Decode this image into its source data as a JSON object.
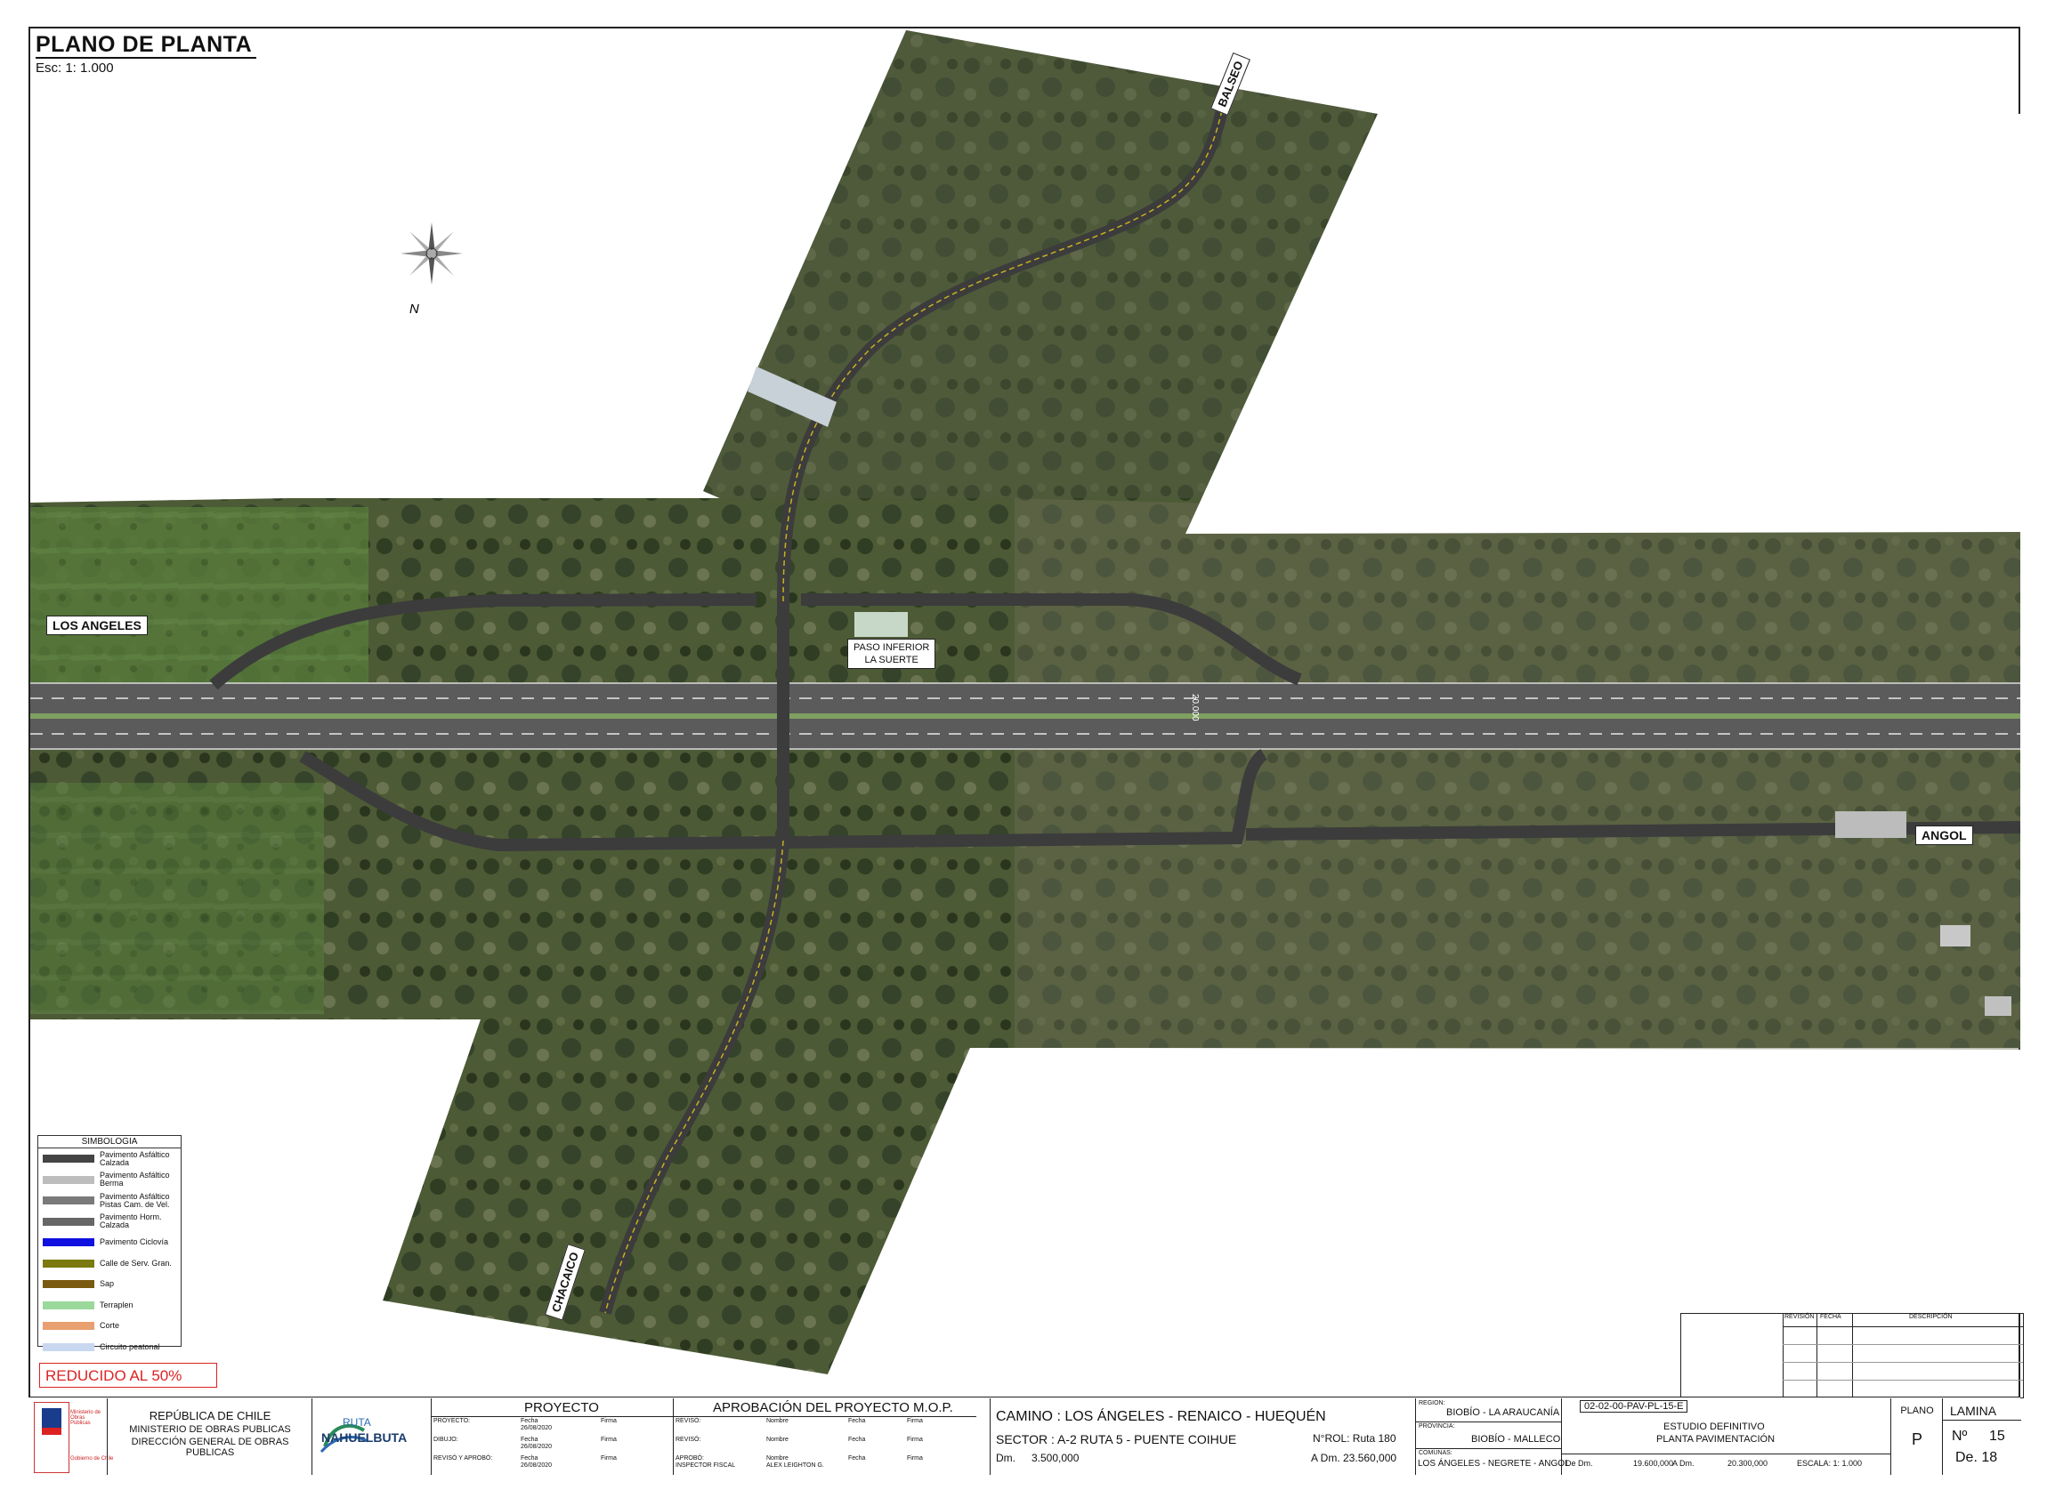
{
  "header": {
    "title": "PLANO DE PLANTA",
    "scale": "Esc: 1: 1.000"
  },
  "north": {
    "label": "N"
  },
  "signs": {
    "balseo": "BALSEO",
    "los_angeles": "LOS ANGELES",
    "angol": "ANGOL",
    "chacaico": "CHACAICO",
    "paso_inferior_1": "PASO INFERIOR",
    "paso_inferior_2": "LA SUERTE",
    "km_mark": "20.000"
  },
  "legend": {
    "title": "SIMBOLOGIA",
    "items": [
      {
        "label": "Pavimento Asfáltico\nCalzada",
        "color": "#444444"
      },
      {
        "label": "Pavimento Asfáltico\nBerma",
        "color": "#bdbdbd"
      },
      {
        "label": "Pavimento Asfáltico\nPistas Cam. de Vel.",
        "color": "#7a7a7a"
      },
      {
        "label": "Pavimento Horm.\nCalzada",
        "color": "#666666"
      },
      {
        "label": "Pavimento Ciclovía",
        "color": "#1010e0"
      },
      {
        "label": "Calle de Serv. Gran.",
        "color": "#7a7a10"
      },
      {
        "label": "Sap",
        "color": "#7a5a10"
      },
      {
        "label": "Terraplen",
        "color": "#9bd89b"
      },
      {
        "label": "Corte",
        "color": "#e8a070"
      },
      {
        "label": "Circuito peatonal",
        "color": "#c8d8f0"
      }
    ]
  },
  "stamp": "REDUCIDO AL 50%",
  "revision_table": {
    "headers": [
      "REVISIÓN",
      "FECHA",
      "DESCRIPCIÓN"
    ]
  },
  "title_block": {
    "ministry": [
      "REPÚBLICA DE CHILE",
      "MINISTERIO DE OBRAS PUBLICAS",
      "DIRECCIÓN GENERAL DE OBRAS PUBLICAS"
    ],
    "logo_small": "Ministerio de Obras Públicas",
    "logo_small2": "Gobierno de Chile",
    "ruta_logo": "RUTA",
    "ruta_logo2": "NAHUELBUTA",
    "proyecto_title": "PROYECTO",
    "proyecto_rows": [
      {
        "role": "PROYECTO:",
        "fecha_lbl": "Fecha",
        "fecha": "26/08/2020",
        "firma": "Firma"
      },
      {
        "role": "DIBUJO:",
        "fecha_lbl": "Fecha",
        "fecha": "26/08/2020",
        "firma": "Firma"
      },
      {
        "role": "REVISÓ Y APROBÓ:",
        "fecha_lbl": "Fecha",
        "fecha": "26/08/2020",
        "firma": "Firma"
      }
    ],
    "aprobacion_title": "APROBACIÓN DEL PROYECTO M.O.P.",
    "aprobacion_rows": [
      {
        "role": "REVISÓ:",
        "nombre_lbl": "Nombre",
        "nombre": "",
        "fecha": "Fecha",
        "firma": "Firma"
      },
      {
        "role": "REVISÓ:",
        "nombre_lbl": "Nombre",
        "nombre": "",
        "fecha": "Fecha",
        "firma": "Firma"
      },
      {
        "role": "APROBÓ:",
        "role2": "INSPECTOR FISCAL",
        "nombre_lbl": "Nombre",
        "nombre": "ALEX LEIGHTON G.",
        "fecha": "Fecha",
        "firma": "Firma"
      }
    ],
    "camino": "CAMINO : LOS ÁNGELES - RENAICO - HUEQUÉN",
    "sector": "SECTOR : A-2  RUTA 5 - PUENTE COIHUE",
    "rol": "N°ROL: Ruta 180",
    "dm_lbl": "Dm.",
    "dm": "3.500,000",
    "a_dm": "A Dm.  23.560,000",
    "region_lbl": "REGION:",
    "region": "BIOBÍO - LA ARAUCANÍA",
    "provincia_lbl": "PROVINCIA:",
    "provincia": "BIOBÍO - MALLECO",
    "comunas_lbl": "COMUNAS:",
    "comunas": "LOS ÁNGELES - NEGRETE - ANGOL",
    "code": "02-02-00-PAV-PL-15-E",
    "estudio": "ESTUDIO DEFINITIVO",
    "planta": "PLANTA PAVIMENTACIÓN",
    "de_dm": "De Dm.",
    "de_dm_val": "19.600,000",
    "a_dm2": "A Dm.",
    "a_dm2_val": "20.300,000",
    "escala": "ESCALA:  1: 1.000",
    "plano_lbl": "PLANO",
    "plano": "P",
    "lamina_lbl": "LAMINA",
    "lamina_no_lbl": "Nº",
    "lamina_no": "15",
    "lamina_de": "De. 18"
  }
}
